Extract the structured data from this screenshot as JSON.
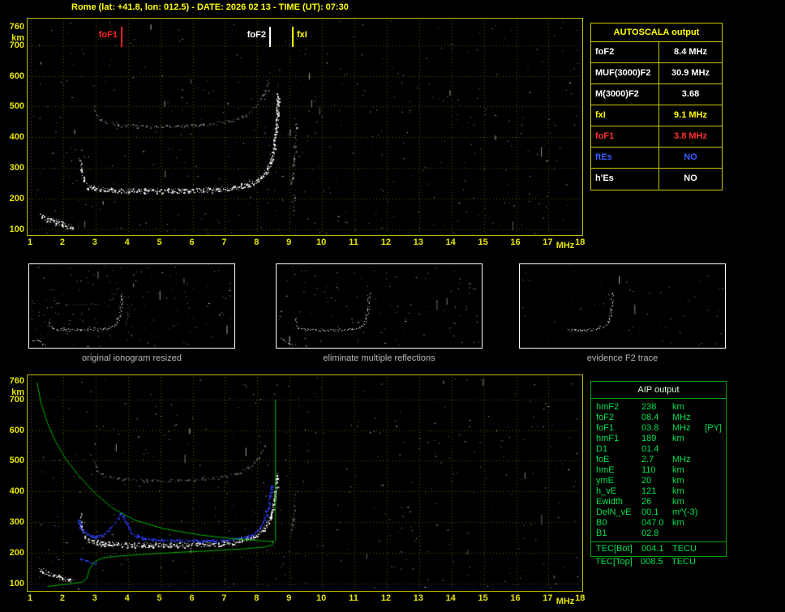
{
  "title": "Rome (lat: +41.8, lon: 012.5) - DATE: 2026 02 13 - TIME (UT): 07:30",
  "colors": {
    "title": "#ffff00",
    "plot_frame": "#b9b900",
    "grid": "#5a5a00",
    "axis_text": "#e6e600",
    "autoscala_border": "#c8c800",
    "aip_border": "#00a000",
    "aip_text": "#00e050",
    "caption_text": "#b8b8b8",
    "trace_white": "#ffffff",
    "restored_trace_blue": "#2a3cf0",
    "profile_green": "#00b400",
    "fof1_red": "#ff2020",
    "fxi_yellow": "#ffff00"
  },
  "autoscala": {
    "header": "AUTOSCALA output",
    "rows": [
      {
        "label": "foF2",
        "value": "8.4 MHz",
        "color": "#ffffff"
      },
      {
        "label": "MUF(3000)F2",
        "value": "30.9 MHz",
        "color": "#ffffff"
      },
      {
        "label": "M(3000)F2",
        "value": "3.68",
        "color": "#ffffff"
      },
      {
        "label": "fxI",
        "value": "9.1 MHz",
        "color": "#ffff00"
      },
      {
        "label": "foF1",
        "value": "3.8 MHz",
        "color": "#ff3030"
      },
      {
        "label": "ftEs",
        "value": "NO",
        "color": "#3a5cff"
      },
      {
        "label": "h'Es",
        "value": "NO",
        "color": "#ffffff"
      }
    ]
  },
  "thumbnails": {
    "captions": [
      "original ionogram resized",
      "eliminate multiple reflections",
      "evidence F2 trace"
    ]
  },
  "aip": {
    "header": "AIP output",
    "rows": [
      {
        "label": "hmF2",
        "value": "238",
        "unit": "km"
      },
      {
        "label": "foF2",
        "value": "08.4",
        "unit": "MHz"
      },
      {
        "label": "foF1",
        "value": "03.8",
        "unit": "MHz",
        "note": "[PY]"
      },
      {
        "label": "hmF1",
        "value": "189",
        "unit": "km"
      },
      {
        "label": "D1",
        "value": "01.4",
        "unit": ""
      },
      {
        "label": "foE",
        "value": "2.7",
        "unit": "MHz"
      },
      {
        "label": "hmE",
        "value": "110",
        "unit": "km"
      },
      {
        "label": "ymE",
        "value": "20",
        "unit": "km"
      },
      {
        "label": "h_vE",
        "value": "121",
        "unit": "km"
      },
      {
        "label": "Ewidth",
        "value": "26",
        "unit": "km"
      },
      {
        "label": "DelN_vE",
        "value": "00.1",
        "unit": "m^(-3)"
      },
      {
        "label": "B0",
        "value": "047.0",
        "unit": "km"
      },
      {
        "label": "B1",
        "value": "02.8",
        "unit": ""
      },
      {
        "label": "TEC[Bot]",
        "value": "004.1",
        "unit": "TECU",
        "sep": true
      },
      {
        "label": "TEC[Top]",
        "value": "008.5",
        "unit": "TECU",
        "outside": true
      }
    ]
  },
  "chart_data": [
    {
      "type": "scatter",
      "title": "measured ionogram",
      "xlabel": "MHz",
      "ylabel": "km",
      "xlim": [
        1,
        18
      ],
      "ylim": [
        90,
        769
      ],
      "x_ticks": [
        1,
        2,
        3,
        4,
        5,
        6,
        7,
        8,
        9,
        10,
        11,
        12,
        13,
        14,
        15,
        16,
        17,
        18
      ],
      "y_ticks": [
        760,
        700,
        600,
        500,
        400,
        300,
        200,
        100
      ],
      "grid": true,
      "markers": [
        {
          "label": "foF1",
          "x": 3.8,
          "color": "#ff2020",
          "side": "left"
        },
        {
          "label": "foF2",
          "x": 8.4,
          "color": "#ffffff",
          "side": "left"
        },
        {
          "label": "fxI",
          "x": 9.1,
          "color": "#ffff00",
          "side": "right"
        }
      ],
      "series": [
        {
          "name": "E-trace",
          "color": "#ffffff",
          "thickness": 6,
          "density": 2.2,
          "points": [
            [
              1.28,
              146
            ],
            [
              1.55,
              134
            ],
            [
              1.85,
              122
            ],
            [
              2.1,
              113
            ],
            [
              2.3,
              108
            ]
          ]
        },
        {
          "name": "F-start",
          "color": "#ffffff",
          "thickness": 3,
          "density": 1.1,
          "points": [
            [
              2.52,
              330
            ],
            [
              2.56,
              295
            ],
            [
              2.62,
              262
            ],
            [
              2.75,
              243
            ]
          ]
        },
        {
          "name": "F-trace",
          "color": "#ffffff",
          "thickness": 6,
          "density": 2.4,
          "points": [
            [
              2.75,
              241
            ],
            [
              3.2,
              231
            ],
            [
              4.0,
              227
            ],
            [
              5.0,
              226
            ],
            [
              6.0,
              227
            ],
            [
              6.8,
              231
            ],
            [
              7.4,
              239
            ],
            [
              7.9,
              255
            ],
            [
              8.2,
              280
            ],
            [
              8.38,
              312
            ],
            [
              8.5,
              358
            ],
            [
              8.58,
              430
            ],
            [
              8.64,
              540
            ]
          ]
        },
        {
          "name": "F-second-order",
          "color": "#c8c8c8",
          "alpha": 0.55,
          "thickness": 4,
          "density": 1.0,
          "points": [
            [
              2.95,
              505
            ],
            [
              3.05,
              468
            ],
            [
              3.3,
              450
            ],
            [
              3.8,
              440
            ],
            [
              4.8,
              436
            ],
            [
              5.8,
              438
            ],
            [
              6.7,
              445
            ],
            [
              7.3,
              458
            ],
            [
              7.75,
              480
            ],
            [
              8.05,
              515
            ],
            [
              8.25,
              560
            ],
            [
              8.35,
              590
            ]
          ]
        },
        {
          "name": "x-mode",
          "color": "#d0d0d0",
          "alpha": 0.6,
          "thickness": 3,
          "density": 0.8,
          "points": [
            [
              9.02,
              250
            ],
            [
              9.08,
              290
            ],
            [
              9.13,
              340
            ],
            [
              9.17,
              400
            ],
            [
              9.2,
              450
            ]
          ]
        },
        {
          "name": "x-mode-low",
          "color": "#d0d0d0",
          "alpha": 0.5,
          "thickness": 2,
          "density": 0.6,
          "points": [
            [
              9.08,
              150
            ],
            [
              9.13,
              195
            ],
            [
              9.17,
              230
            ]
          ]
        }
      ],
      "noise": {
        "seed": 77,
        "dots": 430,
        "streaks": 16
      }
    },
    {
      "type": "scatter",
      "title": "ionogram with restored trace and electron density profile",
      "xlabel": "MHz",
      "ylabel": "km",
      "xlim": [
        1,
        18
      ],
      "ylim": [
        90,
        769
      ],
      "x_ticks": [
        1,
        2,
        3,
        4,
        5,
        6,
        7,
        8,
        9,
        10,
        11,
        12,
        13,
        14,
        15,
        16,
        17,
        18
      ],
      "y_ticks": [
        760,
        700,
        600,
        500,
        400,
        300,
        200,
        100
      ],
      "grid": true,
      "markers": [],
      "series": [
        {
          "name": "E-trace",
          "color": "#ffffff",
          "thickness": 6,
          "density": 2.2,
          "points": [
            [
              1.28,
              146
            ],
            [
              1.55,
              134
            ],
            [
              1.85,
              122
            ],
            [
              2.1,
              113
            ],
            [
              2.3,
              108
            ]
          ]
        },
        {
          "name": "F-start",
          "color": "#ffffff",
          "thickness": 3,
          "density": 1.1,
          "points": [
            [
              2.52,
              330
            ],
            [
              2.56,
              295
            ],
            [
              2.62,
              262
            ],
            [
              2.75,
              243
            ]
          ]
        },
        {
          "name": "F-trace",
          "color": "#ffffff",
          "thickness": 6,
          "density": 2.4,
          "points": [
            [
              2.75,
              241
            ],
            [
              3.2,
              231
            ],
            [
              4.0,
              227
            ],
            [
              5.0,
              226
            ],
            [
              6.0,
              227
            ],
            [
              6.8,
              231
            ],
            [
              7.4,
              239
            ],
            [
              7.9,
              255
            ],
            [
              8.2,
              280
            ],
            [
              8.38,
              312
            ],
            [
              8.5,
              352
            ],
            [
              8.57,
              410
            ],
            [
              8.62,
              460
            ]
          ]
        },
        {
          "name": "F-second-order",
          "color": "#c8c8c8",
          "alpha": 0.45,
          "thickness": 4,
          "density": 0.9,
          "points": [
            [
              2.95,
              505
            ],
            [
              3.05,
              468
            ],
            [
              3.3,
              450
            ],
            [
              3.8,
              440
            ],
            [
              4.8,
              436
            ],
            [
              5.8,
              438
            ],
            [
              6.7,
              445
            ],
            [
              7.3,
              458
            ],
            [
              7.75,
              480
            ],
            [
              8.05,
              515
            ],
            [
              8.25,
              560
            ]
          ]
        },
        {
          "name": "x-mode",
          "color": "#d0d0d0",
          "alpha": 0.5,
          "thickness": 3,
          "density": 0.7,
          "points": [
            [
              9.02,
              250
            ],
            [
              9.08,
              290
            ],
            [
              9.13,
              340
            ],
            [
              9.17,
              400
            ]
          ]
        },
        {
          "name": "restored-trace",
          "color": "#2a3cf0",
          "thickness": 3,
          "density": 2.2,
          "points": [
            [
              2.45,
              305
            ],
            [
              2.6,
              272
            ],
            [
              2.9,
              254
            ],
            [
              3.25,
              260
            ],
            [
              3.55,
              292
            ],
            [
              3.8,
              332
            ],
            [
              3.95,
              296
            ],
            [
              4.15,
              260
            ],
            [
              4.6,
              246
            ],
            [
              5.5,
              241
            ],
            [
              6.5,
              240
            ],
            [
              7.1,
              243
            ],
            [
              7.7,
              254
            ],
            [
              8.0,
              272
            ],
            [
              8.2,
              302
            ],
            [
              8.33,
              348
            ],
            [
              8.43,
              425
            ]
          ]
        },
        {
          "name": "restored-E",
          "color": "#2a3cf0",
          "thickness": 2,
          "density": 1.4,
          "points": [
            [
              2.5,
              182
            ],
            [
              2.8,
              172
            ],
            [
              3.05,
              168
            ]
          ]
        },
        {
          "name": "density-profile",
          "line": true,
          "color": "#00b400",
          "points": [
            [
              1.18,
              758
            ],
            [
              1.3,
              690
            ],
            [
              1.5,
              625
            ],
            [
              1.75,
              565
            ],
            [
              2.05,
              510
            ],
            [
              2.45,
              455
            ],
            [
              2.95,
              398
            ],
            [
              3.5,
              348
            ],
            [
              4.2,
              308
            ],
            [
              5.1,
              280
            ],
            [
              6.2,
              260
            ],
            [
              7.2,
              248
            ],
            [
              8.1,
              241
            ],
            [
              8.5,
              238
            ],
            [
              8.45,
              228
            ],
            [
              8.2,
              220
            ],
            [
              7.5,
              214
            ],
            [
              6.5,
              208
            ],
            [
              5.5,
              203
            ],
            [
              4.5,
              197
            ],
            [
              3.7,
              191
            ],
            [
              3.2,
              185
            ],
            [
              2.95,
              172
            ],
            [
              2.8,
              148
            ],
            [
              2.72,
              118
            ],
            [
              2.6,
              107
            ],
            [
              2.3,
              102
            ],
            [
              1.9,
              97
            ],
            [
              1.5,
              92
            ]
          ]
        },
        {
          "name": "profile-asymptote",
          "line": true,
          "color": "#00b400",
          "points": [
            [
              8.55,
              700
            ],
            [
              8.55,
              238
            ]
          ]
        }
      ],
      "noise": {
        "seed": 99,
        "dots": 380,
        "streaks": 12
      }
    }
  ]
}
